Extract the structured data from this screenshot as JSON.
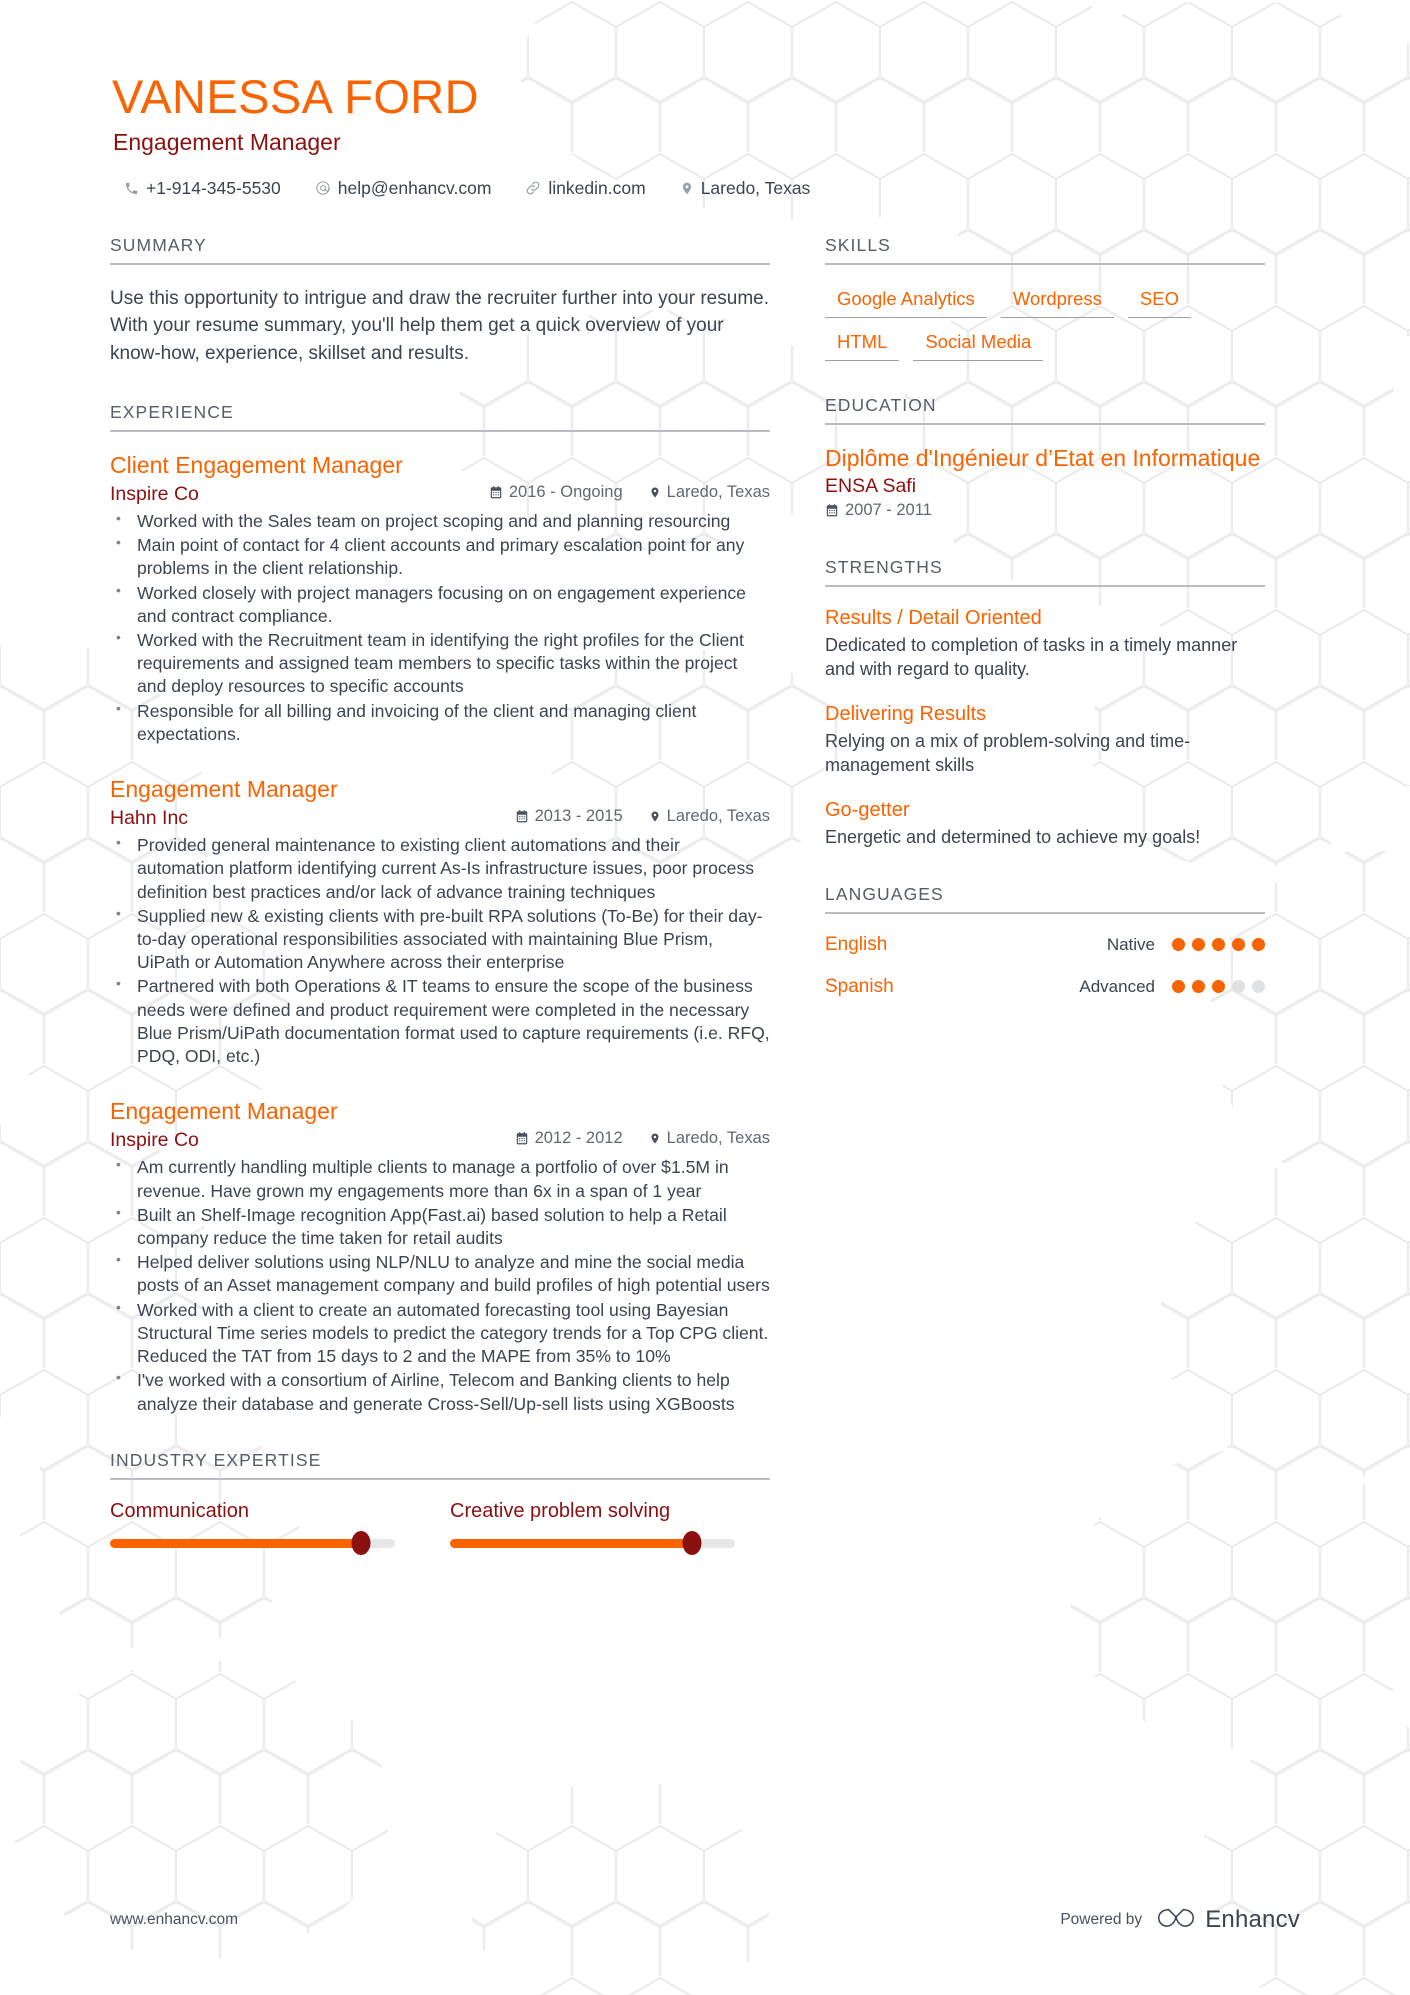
{
  "header": {
    "name": "VANESSA FORD",
    "role": "Engagement Manager",
    "contacts": [
      {
        "icon": "phone-icon",
        "text": "+1-914-345-5530"
      },
      {
        "icon": "email-icon",
        "text": "help@enhancv.com"
      },
      {
        "icon": "link-icon",
        "text": "linkedin.com"
      },
      {
        "icon": "location-icon",
        "text": "Laredo, Texas"
      }
    ]
  },
  "summary": {
    "title": "SUMMARY",
    "text": "Use this opportunity to intrigue and draw the recruiter further into your resume. With your resume summary, you'll help them get a quick overview of your know-how, experience, skillset and results."
  },
  "experience": {
    "title": "EXPERIENCE",
    "jobs": [
      {
        "title": "Client Engagement Manager",
        "company": "Inspire Co",
        "dates": "2016 - Ongoing",
        "location": "Laredo, Texas",
        "bullets": [
          "Worked with the Sales team on project scoping and and planning resourcing",
          "Main point of contact for 4 client accounts and primary escalation point for any problems in the client relationship.",
          "Worked closely with project managers focusing on on engagement experience and contract compliance.",
          "Worked with the Recruitment team in identifying the right profiles for the Client requirements and assigned team members to specific tasks within the project and deploy resources to specific accounts",
          "Responsible for all billing and invoicing of the client and managing client expectations."
        ]
      },
      {
        "title": "Engagement Manager",
        "company": "Hahn Inc",
        "dates": "2013 - 2015",
        "location": "Laredo, Texas",
        "bullets": [
          "Provided general maintenance to existing client automations and their automation platform identifying current As-Is infrastructure issues, poor process definition best practices and/or lack of advance training techniques",
          "Supplied new & existing clients with pre-built RPA solutions (To-Be) for their day-to-day operational responsibilities associated with maintaining Blue Prism, UiPath or Automation Anywhere across their enterprise",
          "Partnered with both Operations & IT teams to ensure the scope of the business needs were defined and product requirement were completed in the necessary Blue Prism/UiPath documentation format used to capture requirements (i.e. RFQ, PDQ, ODI, etc.)"
        ]
      },
      {
        "title": "Engagement Manager",
        "company": "Inspire Co",
        "dates": "2012 - 2012",
        "location": "Laredo, Texas",
        "bullets": [
          "Am currently handling multiple clients to manage a portfolio of over $1.5M in revenue. Have grown my engagements more than 6x in a span of 1 year",
          "Built an Shelf-Image recognition App(Fast.ai) based solution to help a Retail company reduce the time taken for retail audits",
          "Helped deliver solutions using NLP/NLU to analyze and mine the social media posts of an Asset management company and build profiles of high potential users",
          "Worked with a client to create an automated forecasting tool using Bayesian Structural Time series models to predict the category trends for a Top CPG client. Reduced the TAT from 15 days to 2 and the MAPE from 35% to 10%",
          "I've worked with a consortium of Airline, Telecom and Banking clients to help analyze their database and generate Cross-Sell/Up-sell lists using XGBoosts"
        ]
      }
    ]
  },
  "industry_expertise": {
    "title": "INDUSTRY EXPERTISE",
    "items": [
      {
        "label": "Communication",
        "value": 88
      },
      {
        "label": "Creative problem solving",
        "value": 85
      }
    ]
  },
  "skills": {
    "title": "SKILLS",
    "rows": [
      [
        "Google Analytics",
        "Wordpress",
        "SEO"
      ],
      [
        "HTML",
        "Social Media"
      ]
    ]
  },
  "education": {
    "title": "EDUCATION",
    "items": [
      {
        "degree": "Diplôme d'Ingénieur d’Etat en Informatique",
        "school": "ENSA Safi",
        "dates": "2007 - 2011"
      }
    ]
  },
  "strengths": {
    "title": "STRENGTHS",
    "items": [
      {
        "title": "Results / Detail Oriented",
        "text": "Dedicated to completion of tasks in a timely manner and with regard to quality."
      },
      {
        "title": "Delivering Results",
        "text": "Relying on a mix of problem-solving and time-management skills"
      },
      {
        "title": "Go-getter",
        "text": "Energetic and determined to achieve my goals!"
      }
    ]
  },
  "languages": {
    "title": "LANGUAGES",
    "items": [
      {
        "name": "English",
        "level": "Native",
        "dots": 5,
        "total": 5
      },
      {
        "name": "Spanish",
        "level": "Advanced",
        "dots": 3,
        "total": 5
      }
    ]
  },
  "footer": {
    "url": "www.enhancv.com",
    "powered_by": "Powered by",
    "brand": "Enhancv"
  },
  "colors": {
    "accent": "#f96302",
    "secondary": "#8c1010",
    "text": "#3c4450",
    "muted": "#616872",
    "rule": "#b9bcc0",
    "watermark": "#ececee"
  }
}
